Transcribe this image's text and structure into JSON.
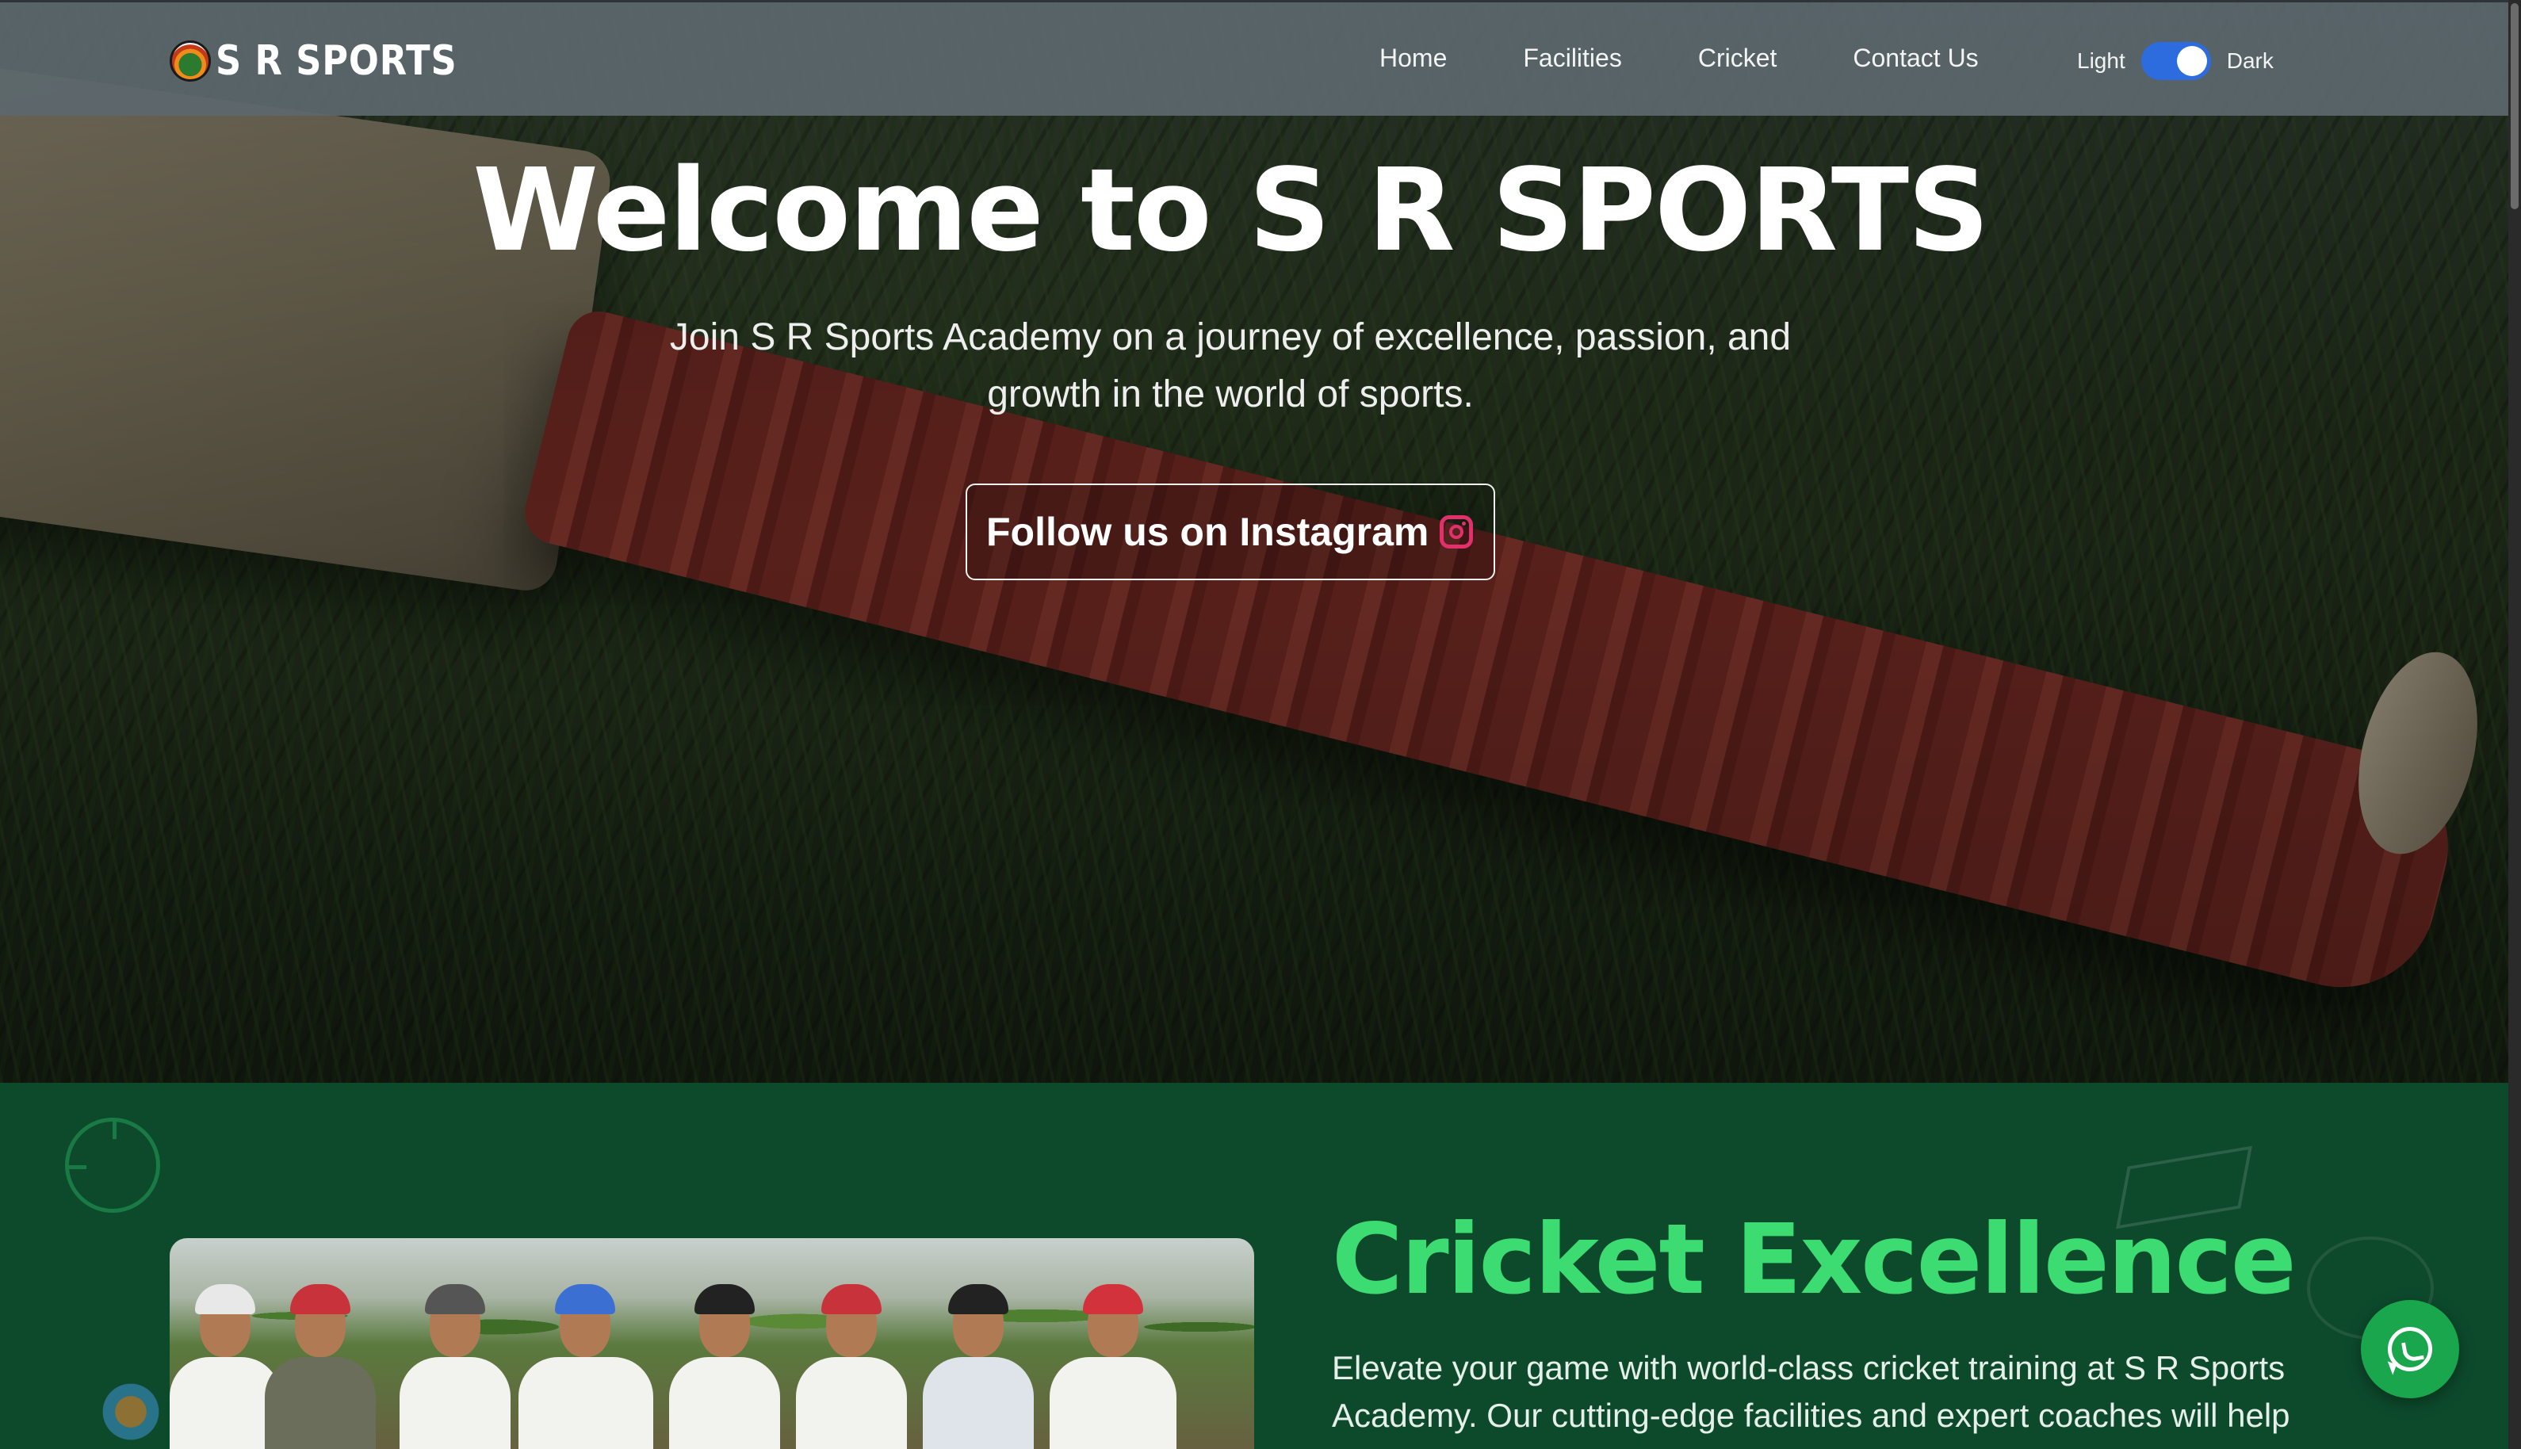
{
  "brand": {
    "logo_text": "S R SPORTS"
  },
  "nav": {
    "items": [
      {
        "label": "Home"
      },
      {
        "label": "Facilities"
      },
      {
        "label": "Cricket"
      },
      {
        "label": "Contact Us"
      }
    ],
    "theme_toggle": {
      "light_label": "Light",
      "dark_label": "Dark",
      "state": "dark"
    }
  },
  "hero": {
    "title": "Welcome to S R SPORTS",
    "subtitle": "Join S R Sports Academy on a journey of excellence, passion, and growth in the world of sports.",
    "cta_label": "Follow us on Instagram",
    "cta_icon": "instagram-icon"
  },
  "cricket": {
    "title": "Cricket Excellence",
    "description": "Elevate your game with world-class cricket training at S R Sports Academy. Our cutting-edge facilities and expert coaches will help"
  },
  "floating": {
    "whatsapp_icon": "whatsapp-icon"
  },
  "colors": {
    "accent_green": "#3ddc72",
    "section_bg": "#0d4a2c",
    "toggle_blue": "#2d6cdf",
    "instagram_pink": "#e1306c",
    "whatsapp_green": "#1aa64c"
  }
}
